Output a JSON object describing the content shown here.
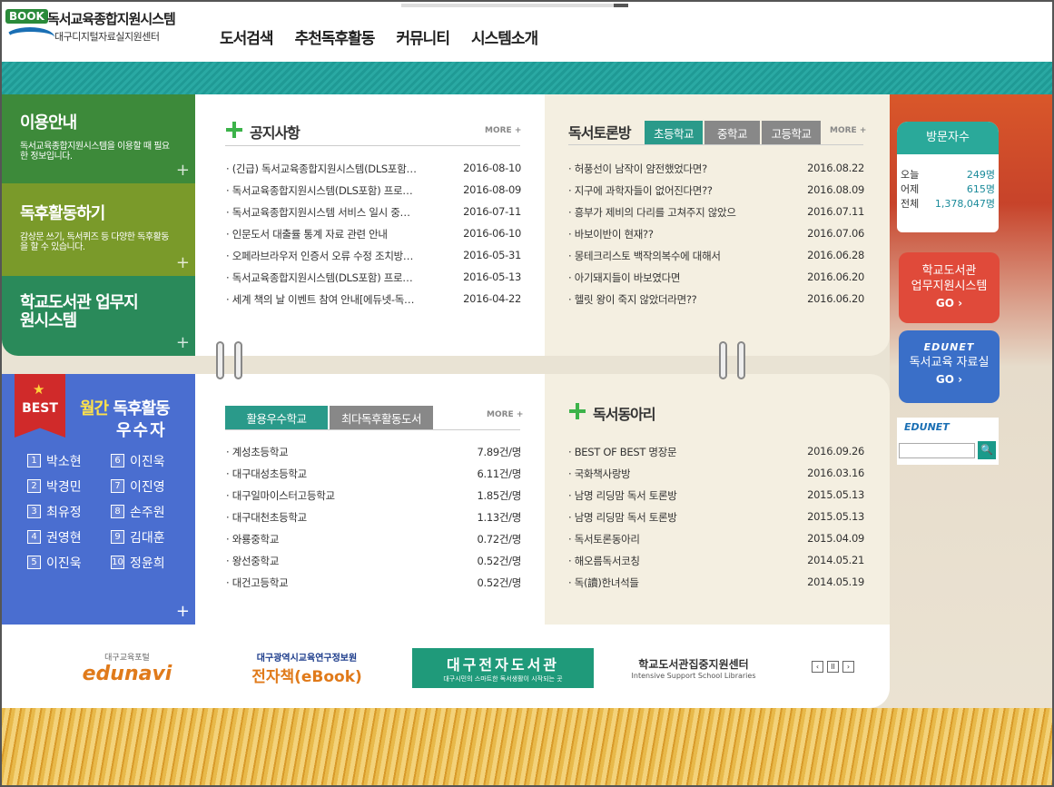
{
  "header": {
    "logo_badge": "BOOK",
    "logo_title": "독서교육종합지원시스템",
    "logo_sub": "대구디지털자료실지원센터",
    "nav": [
      "도서검색",
      "추천독후활동",
      "커뮤니티",
      "시스템소개"
    ]
  },
  "left_panels": [
    {
      "title": "이용안내",
      "desc": "독서교육종합지원시스템을 이용할 때 필요한 정보입니다."
    },
    {
      "title": "독후활동하기",
      "desc": "감상문 쓰기, 독서퀴즈 등 다양한 독후활동을 할 수 있습니다."
    },
    {
      "title": "학교도서관 업무지원시스템",
      "desc": ""
    }
  ],
  "notice": {
    "title": "공지사항",
    "more": "MORE",
    "items": [
      {
        "text": "(긴급) 독서교육종합지원시스템(DLS포함…",
        "date": "2016-08-10"
      },
      {
        "text": "독서교육종합지원시스템(DLS포함) 프로…",
        "date": "2016-08-09"
      },
      {
        "text": "독서교육종합지원시스템 서비스 일시 중…",
        "date": "2016-07-11"
      },
      {
        "text": "인문도서 대출률 통계 자료 관련 안내",
        "date": "2016-06-10"
      },
      {
        "text": "오페라브라우저 인증서 오류 수정 조치방…",
        "date": "2016-05-31"
      },
      {
        "text": "독서교육종합지원시스템(DLS포함) 프로…",
        "date": "2016-05-13"
      },
      {
        "text": "세계 책의 날 이벤트 참여 안내[에듀넷-독…",
        "date": "2016-04-22"
      }
    ]
  },
  "discussion": {
    "title": "독서토론방",
    "tabs": [
      "초등학교",
      "중학교",
      "고등학교"
    ],
    "more": "MORE",
    "items": [
      {
        "text": "허풍선이 남작이 얌전했었다면?",
        "date": "2016.08.22"
      },
      {
        "text": "지구에 과학자들이 없어진다면??",
        "date": "2016.08.09"
      },
      {
        "text": "흥부가 제비의 다리를 고쳐주지 않았으",
        "date": "2016.07.11"
      },
      {
        "text": "바보이반이 현재??",
        "date": "2016.07.06"
      },
      {
        "text": "몽테크리스토 백작의복수에 대해서",
        "date": "2016.06.28"
      },
      {
        "text": "아기돼지들이 바보였다면",
        "date": "2016.06.20"
      },
      {
        "text": "헬릿 왕이 죽지 않았더라면??",
        "date": "2016.06.20"
      }
    ]
  },
  "best": {
    "badge": "BEST",
    "title_a": "월간",
    "title_b": "독후활동",
    "title_c": "우수자",
    "people": [
      {
        "n": "1",
        "name": "박소현"
      },
      {
        "n": "6",
        "name": "이진욱"
      },
      {
        "n": "2",
        "name": "박경민"
      },
      {
        "n": "7",
        "name": "이진영"
      },
      {
        "n": "3",
        "name": "최유정"
      },
      {
        "n": "8",
        "name": "손주원"
      },
      {
        "n": "4",
        "name": "권영현"
      },
      {
        "n": "9",
        "name": "김대훈"
      },
      {
        "n": "5",
        "name": "이진욱"
      },
      {
        "n": "10",
        "name": "정윤희"
      }
    ]
  },
  "schools": {
    "tabs": [
      "활용우수학교",
      "최다독후활동도서"
    ],
    "more": "MORE",
    "items": [
      {
        "text": "계성초등학교",
        "val": "7.89건/명"
      },
      {
        "text": "대구대성초등학교",
        "val": "6.11건/명"
      },
      {
        "text": "대구일마이스터고등학교",
        "val": "1.85건/명"
      },
      {
        "text": "대구대천초등학교",
        "val": "1.13건/명"
      },
      {
        "text": "와룡중학교",
        "val": "0.72건/명"
      },
      {
        "text": "왕선중학교",
        "val": "0.52건/명"
      },
      {
        "text": "대건고등학교",
        "val": "0.52건/명"
      }
    ]
  },
  "club": {
    "title": "독서동아리",
    "items": [
      {
        "text": "BEST OF BEST 명장문",
        "date": "2016.09.26"
      },
      {
        "text": "국화책사랑방",
        "date": "2016.03.16"
      },
      {
        "text": "남명 리딩맘 독서 토론방",
        "date": "2015.05.13"
      },
      {
        "text": "남명 리딩맘 독서 토론방",
        "date": "2015.05.13"
      },
      {
        "text": "독서토론동아리",
        "date": "2015.04.09"
      },
      {
        "text": "해오름독서코칭",
        "date": "2014.05.21"
      },
      {
        "text": "독(讀)한녀석들",
        "date": "2014.05.19"
      }
    ]
  },
  "visitors": {
    "title": "방문자수",
    "rows": [
      {
        "label": "오늘",
        "value": "249명"
      },
      {
        "label": "어제",
        "value": "615명"
      },
      {
        "label": "전체",
        "value": "1,378,047명"
      }
    ]
  },
  "quick": [
    {
      "line1": "학교도서관",
      "line2": "업무지원시스템",
      "go": "GO ›"
    },
    {
      "brand": "EDUNET",
      "line1": "독서교육 자료실",
      "go": "GO ›"
    }
  ],
  "edunet_search": {
    "brand": "EDUNET",
    "button": "🔍"
  },
  "banners": {
    "b1_small": "대구교육포털",
    "b1": "edunavi",
    "b2_small": "대구광역시교육연구정보원",
    "b2": "전자책(eBook)",
    "b3": "대구전자도서관",
    "b3_small": "대구시민의 스마트한 독서생활이 시작되는 곳",
    "b4": "학교도서관집중지원센터",
    "b4_small": "Intensive Support School Libraries",
    "ctrl": [
      "‹",
      "II",
      "›"
    ]
  }
}
